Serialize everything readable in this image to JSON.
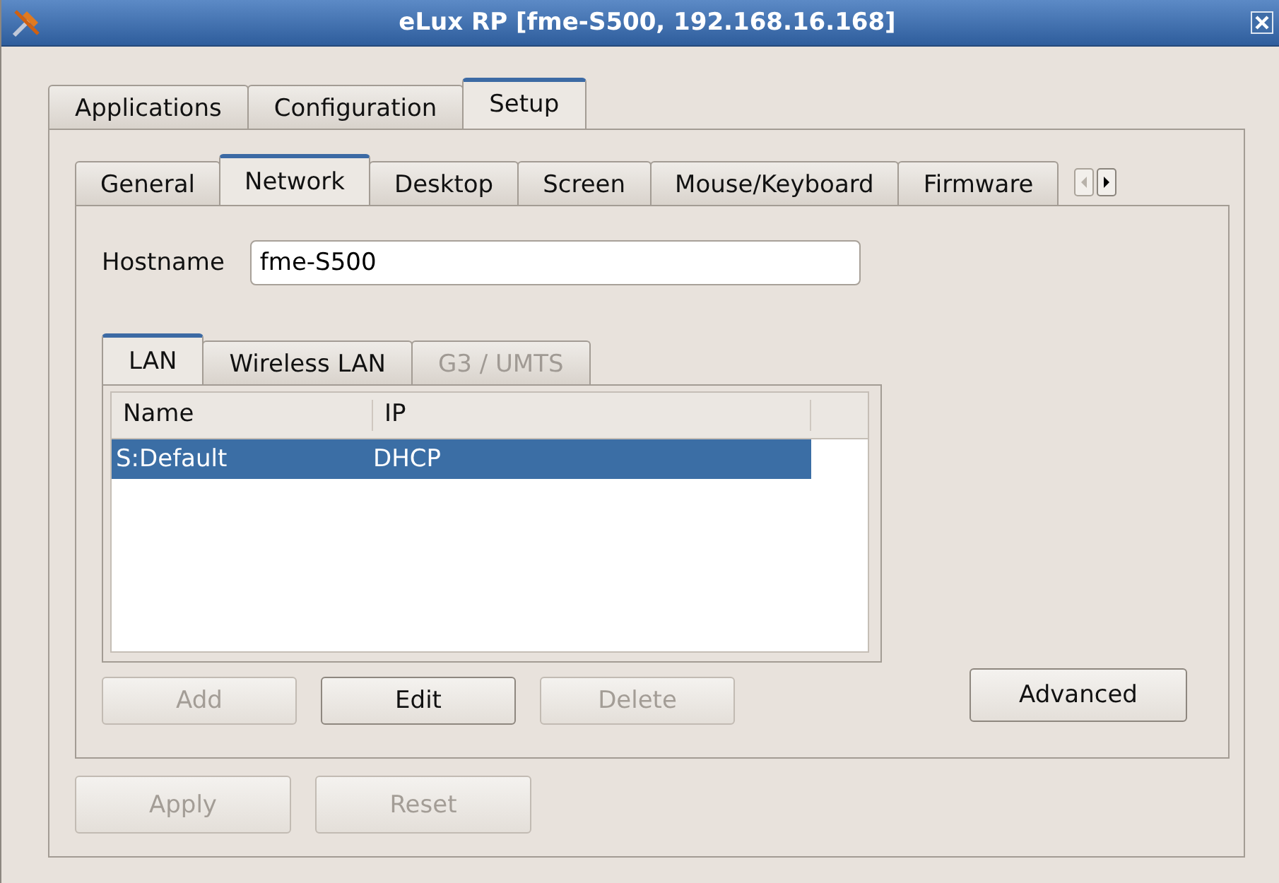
{
  "window": {
    "title": "eLux RP [fme-S500, 192.168.16.168]"
  },
  "tabs": [
    {
      "label": "Applications",
      "selected": false
    },
    {
      "label": "Configuration",
      "selected": false
    },
    {
      "label": "Setup",
      "selected": true
    }
  ],
  "subtabs": [
    {
      "label": "General",
      "selected": false
    },
    {
      "label": "Network",
      "selected": true
    },
    {
      "label": "Desktop",
      "selected": false
    },
    {
      "label": "Screen",
      "selected": false
    },
    {
      "label": "Mouse/Keyboard",
      "selected": false
    },
    {
      "label": "Firmware",
      "selected": false
    }
  ],
  "subtab_scroll": {
    "left_disabled": true,
    "right_disabled": false
  },
  "hostname": {
    "label": "Hostname",
    "value": "fme-S500"
  },
  "connection_tabs": [
    {
      "label": "LAN",
      "selected": true,
      "disabled": false
    },
    {
      "label": "Wireless LAN",
      "selected": false,
      "disabled": false
    },
    {
      "label": "G3 / UMTS",
      "selected": false,
      "disabled": true
    }
  ],
  "table": {
    "columns": [
      "Name",
      "IP"
    ],
    "rows": [
      {
        "cells": [
          "S:Default",
          "DHCP"
        ],
        "selected": true
      }
    ]
  },
  "list_buttons": [
    {
      "label": "Add",
      "disabled": true
    },
    {
      "label": "Edit",
      "disabled": false
    },
    {
      "label": "Delete",
      "disabled": true
    }
  ],
  "advanced_button": {
    "label": "Advanced",
    "disabled": false
  },
  "footer_buttons": [
    {
      "label": "Apply",
      "disabled": true
    },
    {
      "label": "Reset",
      "disabled": true
    }
  ]
}
